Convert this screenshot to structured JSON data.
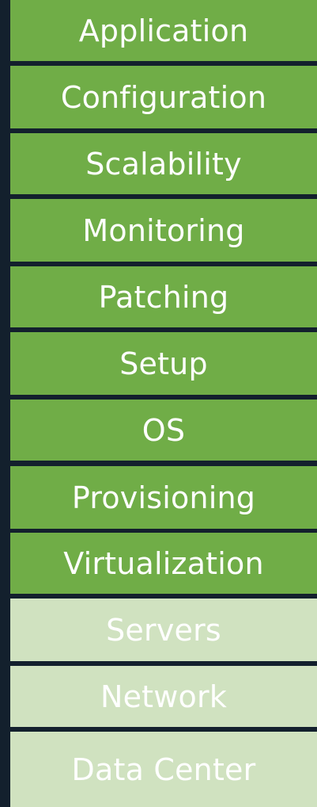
{
  "layers": [
    {
      "label": "Application",
      "tone": "dark"
    },
    {
      "label": "Configuration",
      "tone": "dark"
    },
    {
      "label": "Scalability",
      "tone": "dark"
    },
    {
      "label": "Monitoring",
      "tone": "dark"
    },
    {
      "label": "Patching",
      "tone": "dark"
    },
    {
      "label": "Setup",
      "tone": "dark"
    },
    {
      "label": "OS",
      "tone": "dark"
    },
    {
      "label": "Provisioning",
      "tone": "dark"
    },
    {
      "label": "Virtualization",
      "tone": "dark"
    },
    {
      "label": "Servers",
      "tone": "light"
    },
    {
      "label": "Network",
      "tone": "light"
    },
    {
      "label": "Data Center",
      "tone": "light"
    }
  ],
  "colors": {
    "background": "#13202d",
    "dark_green": "#70ad47",
    "light_green": "#d0e2c0",
    "text": "#ffffff"
  }
}
